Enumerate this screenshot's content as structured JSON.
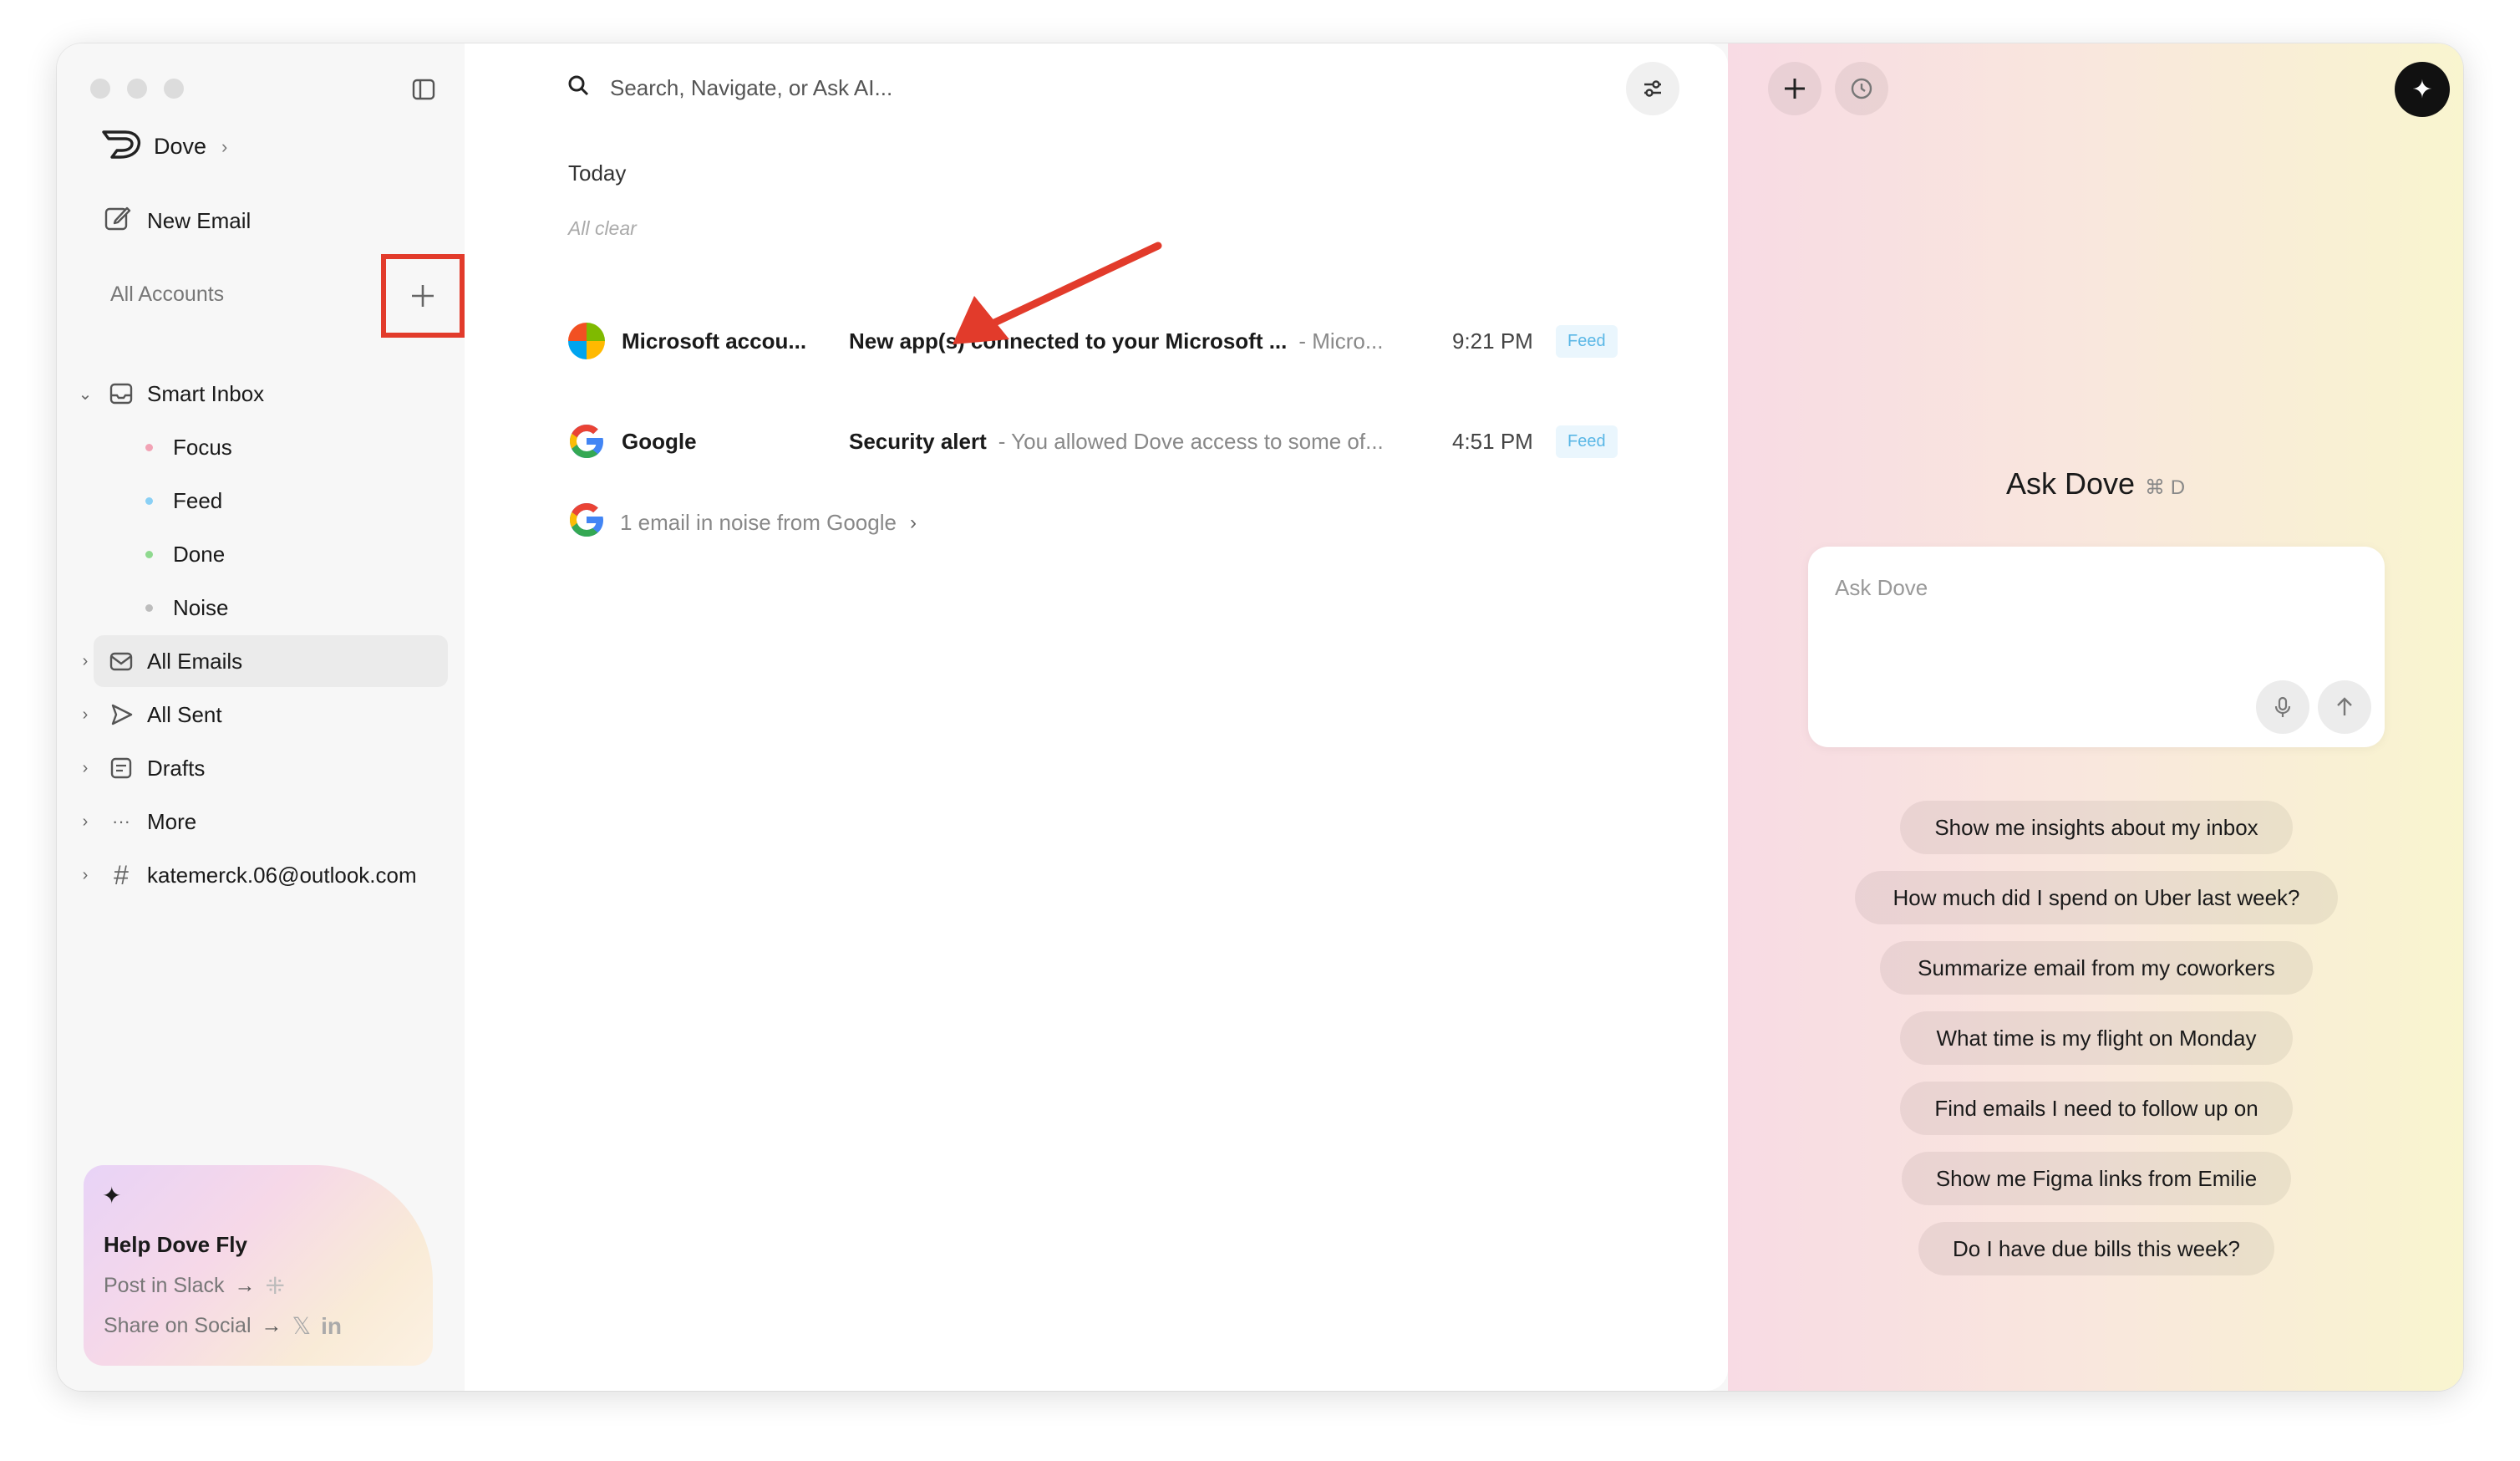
{
  "sidebar": {
    "brand": "Dove",
    "new_email": "New Email",
    "accounts_label": "All Accounts",
    "smart_inbox": "Smart Inbox",
    "sub_items": [
      {
        "label": "Focus",
        "color": "#f2a3b5"
      },
      {
        "label": "Feed",
        "color": "#8ad0f5"
      },
      {
        "label": "Done",
        "color": "#8fd98f"
      },
      {
        "label": "Noise",
        "color": "#bdbdbd"
      }
    ],
    "all_emails": "All Emails",
    "all_sent": "All Sent",
    "drafts": "Drafts",
    "more": "More",
    "account_email": "katemerck.06@outlook.com",
    "help": {
      "title": "Help Dove Fly",
      "slack": "Post in Slack",
      "social": "Share on Social"
    }
  },
  "main": {
    "search_placeholder": "Search, Navigate, or Ask AI...",
    "section": "Today",
    "all_clear": "All clear",
    "emails": [
      {
        "sender": "Microsoft accou...",
        "subject": "New app(s) connected to your Microsoft ...",
        "preview": "- Micro...",
        "time": "9:21 PM",
        "tag": "Feed"
      },
      {
        "sender": "Google",
        "subject": "Security alert",
        "preview": "- You allowed Dove access to some of...",
        "time": "4:51 PM",
        "tag": "Feed"
      }
    ],
    "noise_line": "1 email in noise from Google"
  },
  "ai": {
    "title": "Ask Dove",
    "shortcut": "⌘ D",
    "placeholder": "Ask Dove",
    "suggestions": [
      "Show me insights about my inbox",
      "How much did I spend on Uber last week?",
      "Summarize email from my coworkers",
      "What time is my flight on Monday",
      "Find emails I need to follow up on",
      "Show me Figma links from Emilie",
      "Do I have due bills this week?"
    ]
  },
  "colors": {
    "annotation_red": "#e23b2b",
    "feed_tag": "#5ab7e6"
  }
}
